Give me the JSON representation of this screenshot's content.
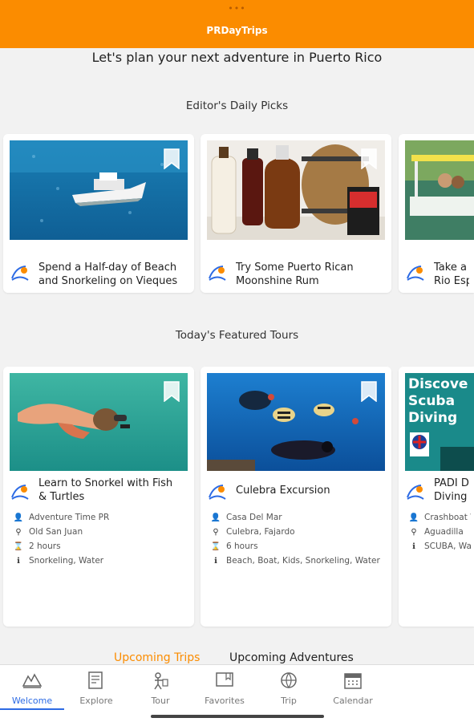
{
  "app": {
    "dots": "•••",
    "title": "PRDayTrips",
    "accent": "#fb8c00",
    "active_color": "#2d6be4"
  },
  "tagline": "Let's plan your next adventure in Puerto Rico",
  "editors_picks": {
    "title": "Editor's Daily Picks",
    "cards": [
      {
        "title_lines": [
          "Spend a Half-day of Beach",
          "and Snorkeling on Vieques"
        ],
        "icon": "tour-logo-icon"
      },
      {
        "title_lines": [
          "Try Some Puerto Rican",
          "Moonshine Rum"
        ],
        "icon": "tour-logo-icon"
      },
      {
        "title_lines": [
          "Take a R",
          "Rio Esp"
        ],
        "icon": "tour-logo-icon"
      }
    ]
  },
  "featured_tours": {
    "title": "Today's Featured Tours",
    "cards": [
      {
        "title_lines": [
          "Learn to Snorkel with Fish",
          "& Turtles"
        ],
        "operator": "Adventure Time PR",
        "location": "Old San Juan",
        "duration": "2 hours",
        "tags": "Snorkeling, Water"
      },
      {
        "title_lines": [
          "Culebra Excursion"
        ],
        "operator": "Casa Del Mar",
        "location": "Culebra, Fajardo",
        "duration": "6 hours",
        "tags": "Beach, Boat, Kids, Snorkeling, Water"
      },
      {
        "title_lines": [
          "PADI Di",
          "Diving A"
        ],
        "image_text": [
          "Discove",
          "Scuba",
          "Diving"
        ],
        "operator": "Crashboat W",
        "location": "Aguadilla",
        "duration": "",
        "tags": "SCUBA, Wat"
      }
    ]
  },
  "trip_tabs": {
    "upcoming_trips": "Upcoming Trips",
    "upcoming_adventures": "Upcoming Adventures"
  },
  "bottom_nav": [
    {
      "label": "Welcome",
      "icon": "welcome-icon",
      "active": true
    },
    {
      "label": "Explore",
      "icon": "explore-icon",
      "active": false
    },
    {
      "label": "Tour",
      "icon": "tour-icon",
      "active": false
    },
    {
      "label": "Favorites",
      "icon": "favorites-icon",
      "active": false
    },
    {
      "label": "Trip",
      "icon": "trip-icon",
      "active": false
    },
    {
      "label": "Calendar",
      "icon": "calendar-icon",
      "active": false
    }
  ]
}
